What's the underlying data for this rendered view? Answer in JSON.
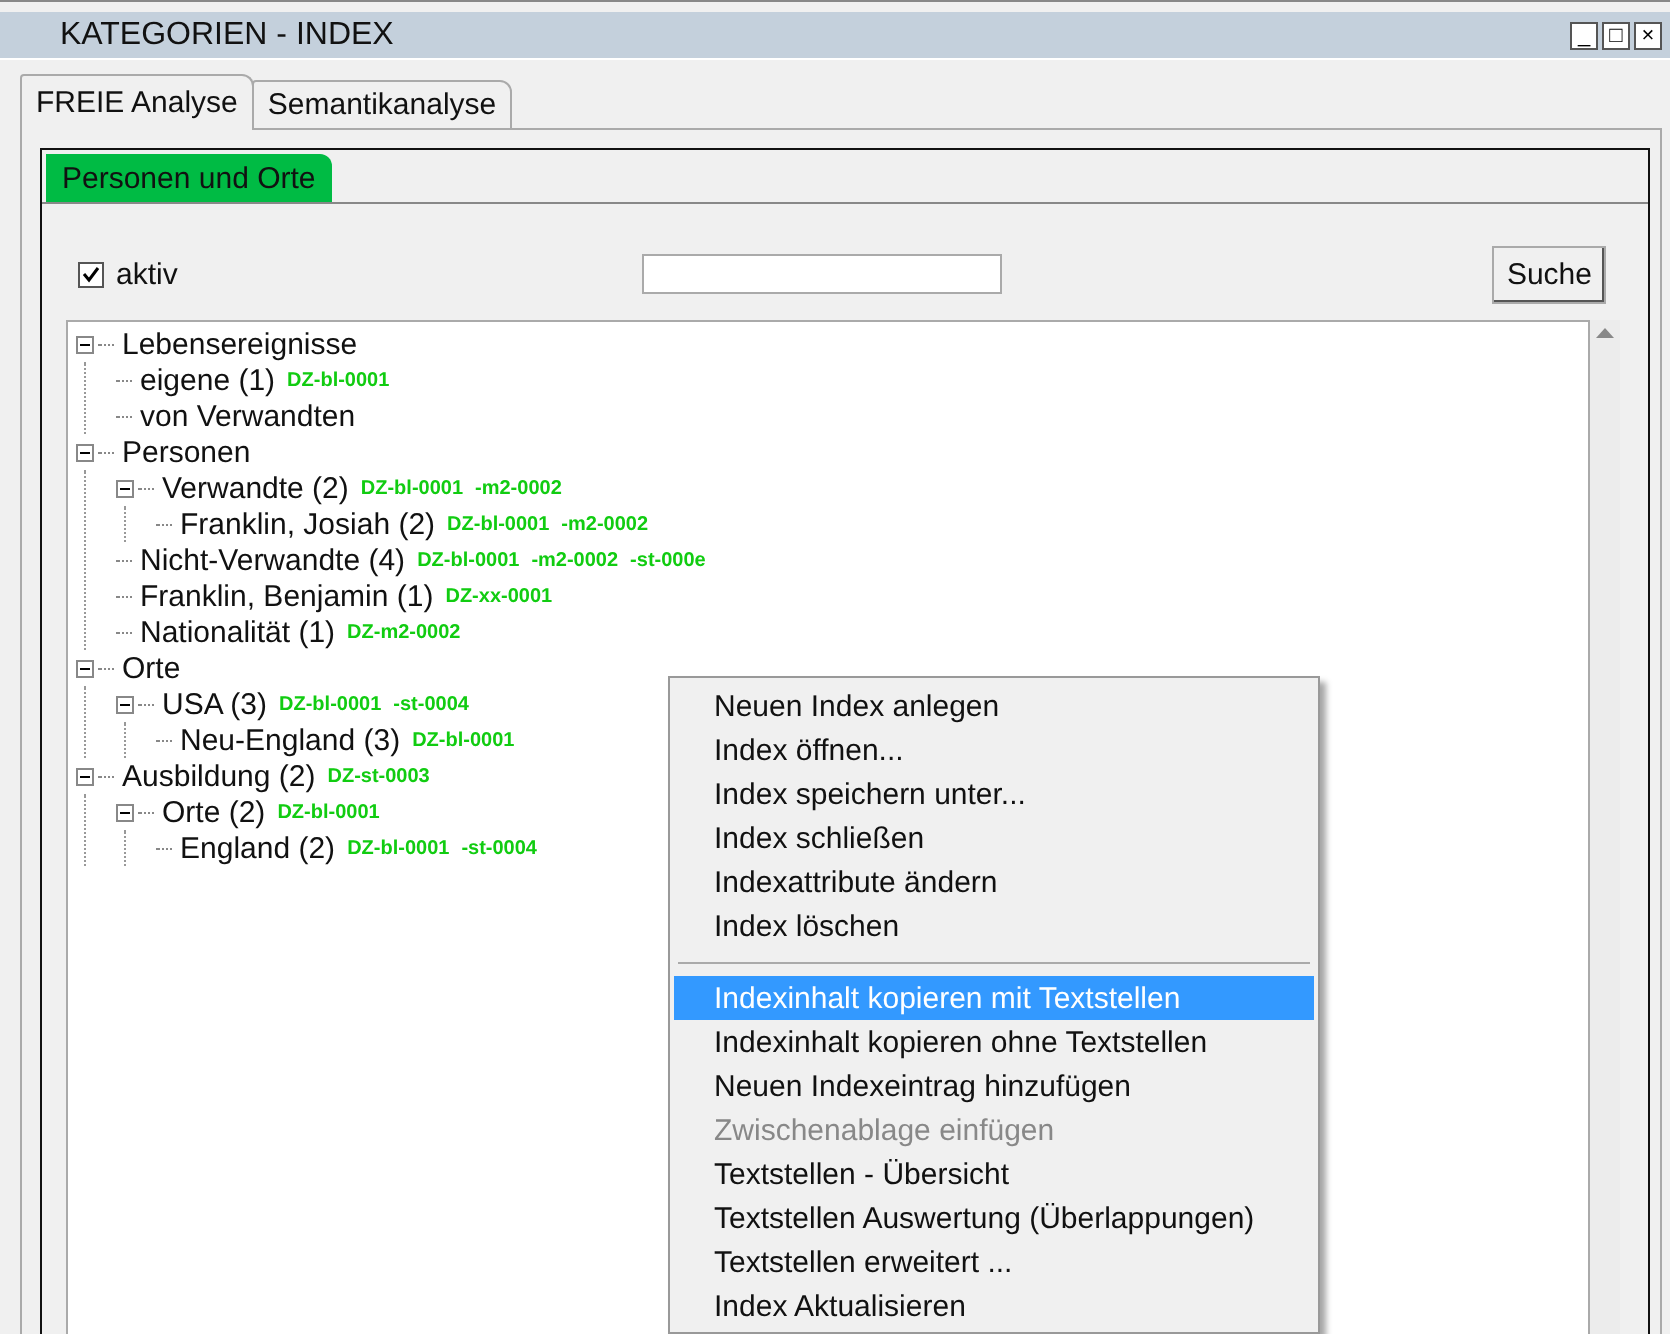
{
  "window": {
    "title": "KATEGORIEN - INDEX",
    "controls": [
      "_",
      "□",
      "×"
    ]
  },
  "tabs": [
    {
      "label": "FREIE Analyse",
      "selected": true
    },
    {
      "label": "Semantikanalyse",
      "selected": false
    }
  ],
  "subtabs": [
    {
      "label": "Personen und Orte",
      "selected": true
    }
  ],
  "active_checkbox": {
    "label": "aktiv",
    "checked": true
  },
  "search_button": "Suche",
  "tree": [
    {
      "label": "Lebensereignisse",
      "expanded": true,
      "children": [
        {
          "label": "eigene (1)",
          "codes": [
            "DZ-bl-0001"
          ]
        },
        {
          "label": "von Verwandten"
        }
      ]
    },
    {
      "label": "Personen",
      "expanded": true,
      "children": [
        {
          "label": "Verwandte (2)",
          "codes": [
            "DZ-bl-0001",
            "-m2-0002"
          ],
          "expanded": true,
          "children": [
            {
              "label": "Franklin, Josiah (2)",
              "codes": [
                "DZ-bl-0001",
                "-m2-0002"
              ]
            }
          ]
        },
        {
          "label": "Nicht-Verwandte (4)",
          "codes": [
            "DZ-bl-0001",
            "-m2-0002",
            "-st-000e"
          ]
        },
        {
          "label": "Franklin, Benjamin (1)",
          "codes": [
            "DZ-xx-0001"
          ]
        },
        {
          "label": "Nationalität (1)",
          "codes": [
            "DZ-m2-0002"
          ]
        }
      ]
    },
    {
      "label": "Orte",
      "expanded": true,
      "children": [
        {
          "label": "USA (3)",
          "codes": [
            "DZ-bl-0001",
            "-st-0004"
          ],
          "expanded": true,
          "children": [
            {
              "label": "Neu-England (3)",
              "codes": [
                "DZ-bl-0001"
              ]
            }
          ]
        }
      ]
    },
    {
      "label": "Ausbildung (2)",
      "codes": [
        "DZ-st-0003"
      ],
      "expanded": true,
      "children": [
        {
          "label": "Orte (2)",
          "codes": [
            "DZ-bl-0001"
          ],
          "expanded": true,
          "children": [
            {
              "label": "England (2)",
              "codes": [
                "DZ-bl-0001",
                "-st-0004"
              ]
            }
          ]
        }
      ]
    }
  ],
  "context_menu": [
    {
      "kind": "item",
      "label": "Neuen Index anlegen",
      "selected": false,
      "disabled": false
    },
    {
      "kind": "item",
      "label": "Index öffnen...",
      "selected": false,
      "disabled": false
    },
    {
      "kind": "item",
      "label": "Index speichern unter...",
      "selected": false,
      "disabled": false
    },
    {
      "kind": "item",
      "label": "Index schließen",
      "selected": false,
      "disabled": false
    },
    {
      "kind": "item",
      "label": "Indexattribute ändern",
      "selected": false,
      "disabled": false
    },
    {
      "kind": "item",
      "label": "Index löschen",
      "selected": false,
      "disabled": false
    },
    {
      "kind": "separator"
    },
    {
      "kind": "item",
      "label": "Indexinhalt kopieren mit Textstellen",
      "selected": true,
      "disabled": false
    },
    {
      "kind": "item",
      "label": "Indexinhalt kopieren ohne Textstellen",
      "selected": false,
      "disabled": false
    },
    {
      "kind": "item",
      "label": "Neuen Indexeintrag hinzufügen",
      "selected": false,
      "disabled": false
    },
    {
      "kind": "item",
      "label": "Zwischenablage einfügen",
      "selected": false,
      "disabled": true
    },
    {
      "kind": "item",
      "label": "Textstellen - Übersicht",
      "selected": false,
      "disabled": false
    },
    {
      "kind": "item",
      "label": "Textstellen Auswertung (Überlappungen)",
      "selected": false,
      "disabled": false
    },
    {
      "kind": "item",
      "label": "Textstellen erweitert ...",
      "selected": false,
      "disabled": false
    },
    {
      "kind": "item",
      "label": "Index Aktualisieren",
      "selected": false,
      "disabled": false
    }
  ]
}
